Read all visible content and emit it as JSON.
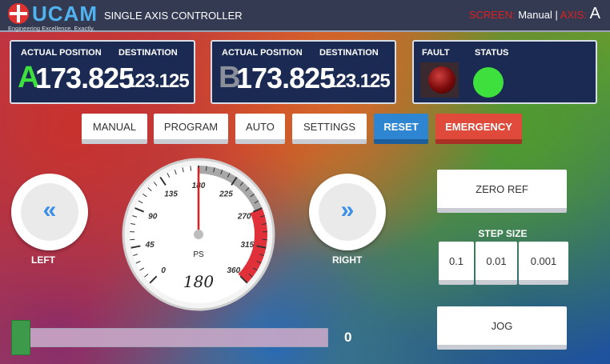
{
  "header": {
    "logo_text": "UCAM",
    "tagline": "Engineering Excellence. Exactly.",
    "title": "SINGLE AXIS CONTROLLER",
    "screen_label": "SCREEN:",
    "screen_value": "Manual",
    "separator": "|",
    "axis_label": "AXIS:",
    "axis_value": "A"
  },
  "axis_a": {
    "actual_label": "ACTUAL POSITION",
    "dest_label": "DESTINATION",
    "letter": "A",
    "actual": "173.825",
    "destination": "123.125",
    "letter_color": "#3ee03e"
  },
  "axis_b": {
    "actual_label": "ACTUAL POSITION",
    "dest_label": "DESTINATION",
    "letter": "B",
    "actual": "173.825",
    "destination": "123.125",
    "letter_color": "#8a8f9a"
  },
  "indicators": {
    "fault_label": "FAULT",
    "status_label": "STATUS",
    "fault_on": false,
    "status_on": true
  },
  "modes": {
    "manual": "MANUAL",
    "program": "PROGRAM",
    "auto": "AUTO",
    "settings": "SETTINGS",
    "reset": "RESET",
    "emergency": "EMERGENCY"
  },
  "jog_left": {
    "icon": "double-chevron-left-icon",
    "glyph": "«",
    "label": "LEFT"
  },
  "jog_right": {
    "icon": "double-chevron-right-icon",
    "glyph": "»",
    "label": "RIGHT"
  },
  "gauge": {
    "min": 0,
    "max": 360,
    "ticks": [
      "0",
      "45",
      "90",
      "135",
      "180",
      "225",
      "270",
      "315",
      "360"
    ],
    "unit": "PS",
    "value": 180,
    "value_text": "180",
    "gray_band": [
      180,
      270
    ],
    "red_band": [
      270,
      360
    ]
  },
  "zero_ref": "ZERO REF",
  "step_size": {
    "label": "STEP SIZE",
    "options": [
      "0.1",
      "0.01",
      "0.001"
    ]
  },
  "jog_button": "JOG",
  "slider": {
    "value": 0,
    "value_text": "0"
  }
}
